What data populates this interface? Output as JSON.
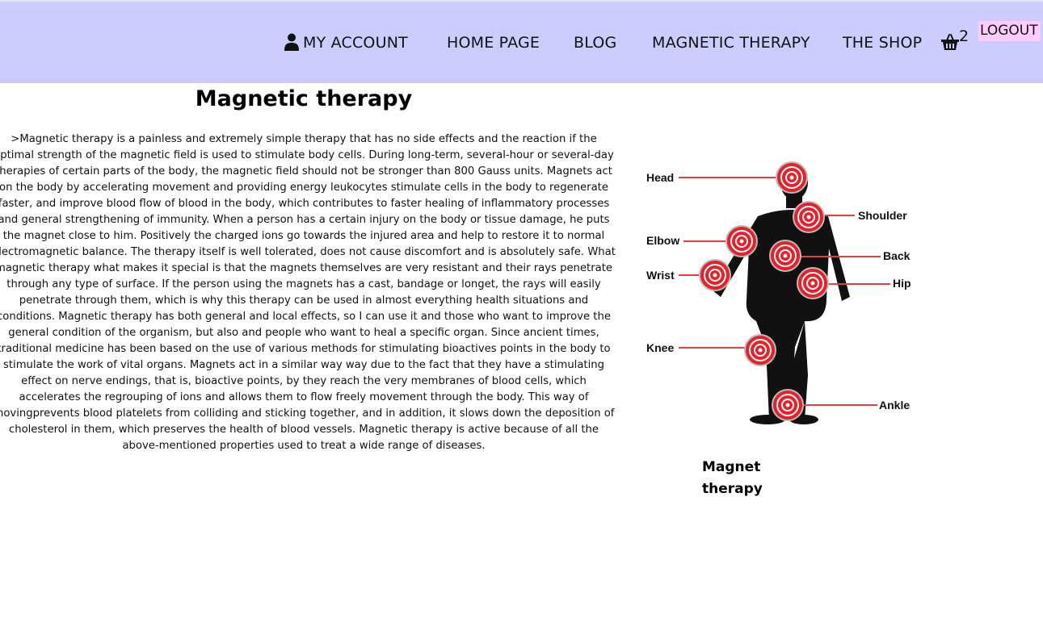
{
  "header": {
    "nav": {
      "my_account": "MY ACCOUNT",
      "home": "HOME PAGE",
      "blog": "BLOG",
      "magnetic_therapy": "MAGNETIC THERAPY",
      "shop": "THE SHOP"
    },
    "cart_count": "2",
    "logout": "LOGOUT"
  },
  "main": {
    "title": "Magnetic therapy",
    "paragraph": ">Magnetic therapy is a painless and extremely simple therapy that has no side effects and the reaction if the optimal strength of the magnetic field is used to stimulate body cells. During long-term, several-hour or several-day therapies of certain parts of the body, the magnetic field should not be stronger than 800 Gauss units. Magnets act on the body by accelerating movement and providing energy leukocytes stimulate cells in the body to regenerate faster, and improve blood flow of blood in the body, which contributes to faster healing of inflammatory processes and general strengthening of immunity. When a person has a certain injury on the body or tissue damage, he puts the magnet close to him. Positively the charged ions go towards the injured area and help to restore it to normal electromagnetic balance. The therapy itself is well tolerated, does not cause discomfort and is absolutely safe. What magnetic therapy what makes it special is that the magnets themselves are very resistant and their rays penetrate through any type of surface. If the person using the magnets has a cast, bandage or longet, the rays will easily penetrate through them, which is why this therapy can be used in almost everything health situations and conditions. Magnetic therapy has both general and local effects, so I can use it and those who want to improve the general condition of the organism, but also and people who want to heal a specific organ. Since ancient times, traditional medicine has been based on the use of various methods for stimulating bioactives points in the body to stimulate the work of vital organs. Magnets act in a similar way way due to the fact that they have a stimulating effect on nerve endings, that is, bioactive points, by they reach the very membranes of blood cells, which accelerates the regrouping of ions and allows them to flow freely movement through the body. This way of movingprevents blood platelets from colliding and sticking together, and in addition, it slows down the deposition of cholesterol in them, which preserves the health of blood vessels. Magnetic therapy is active because of all the above-mentioned properties used to treat a wide range of diseases."
  },
  "figure": {
    "labels": {
      "head": "Head",
      "shoulder": "Shoulder",
      "elbow": "Elbow",
      "back": "Back",
      "wrist": "Wrist",
      "hip": "Hip",
      "knee": "Knee",
      "ankle": "Ankle"
    },
    "caption": "Magnet therapy"
  },
  "colors": {
    "header_bg": "#ccccff",
    "logout_bg": "#ffccff",
    "target_red": "#e8202a",
    "line_red": "#e04040"
  }
}
